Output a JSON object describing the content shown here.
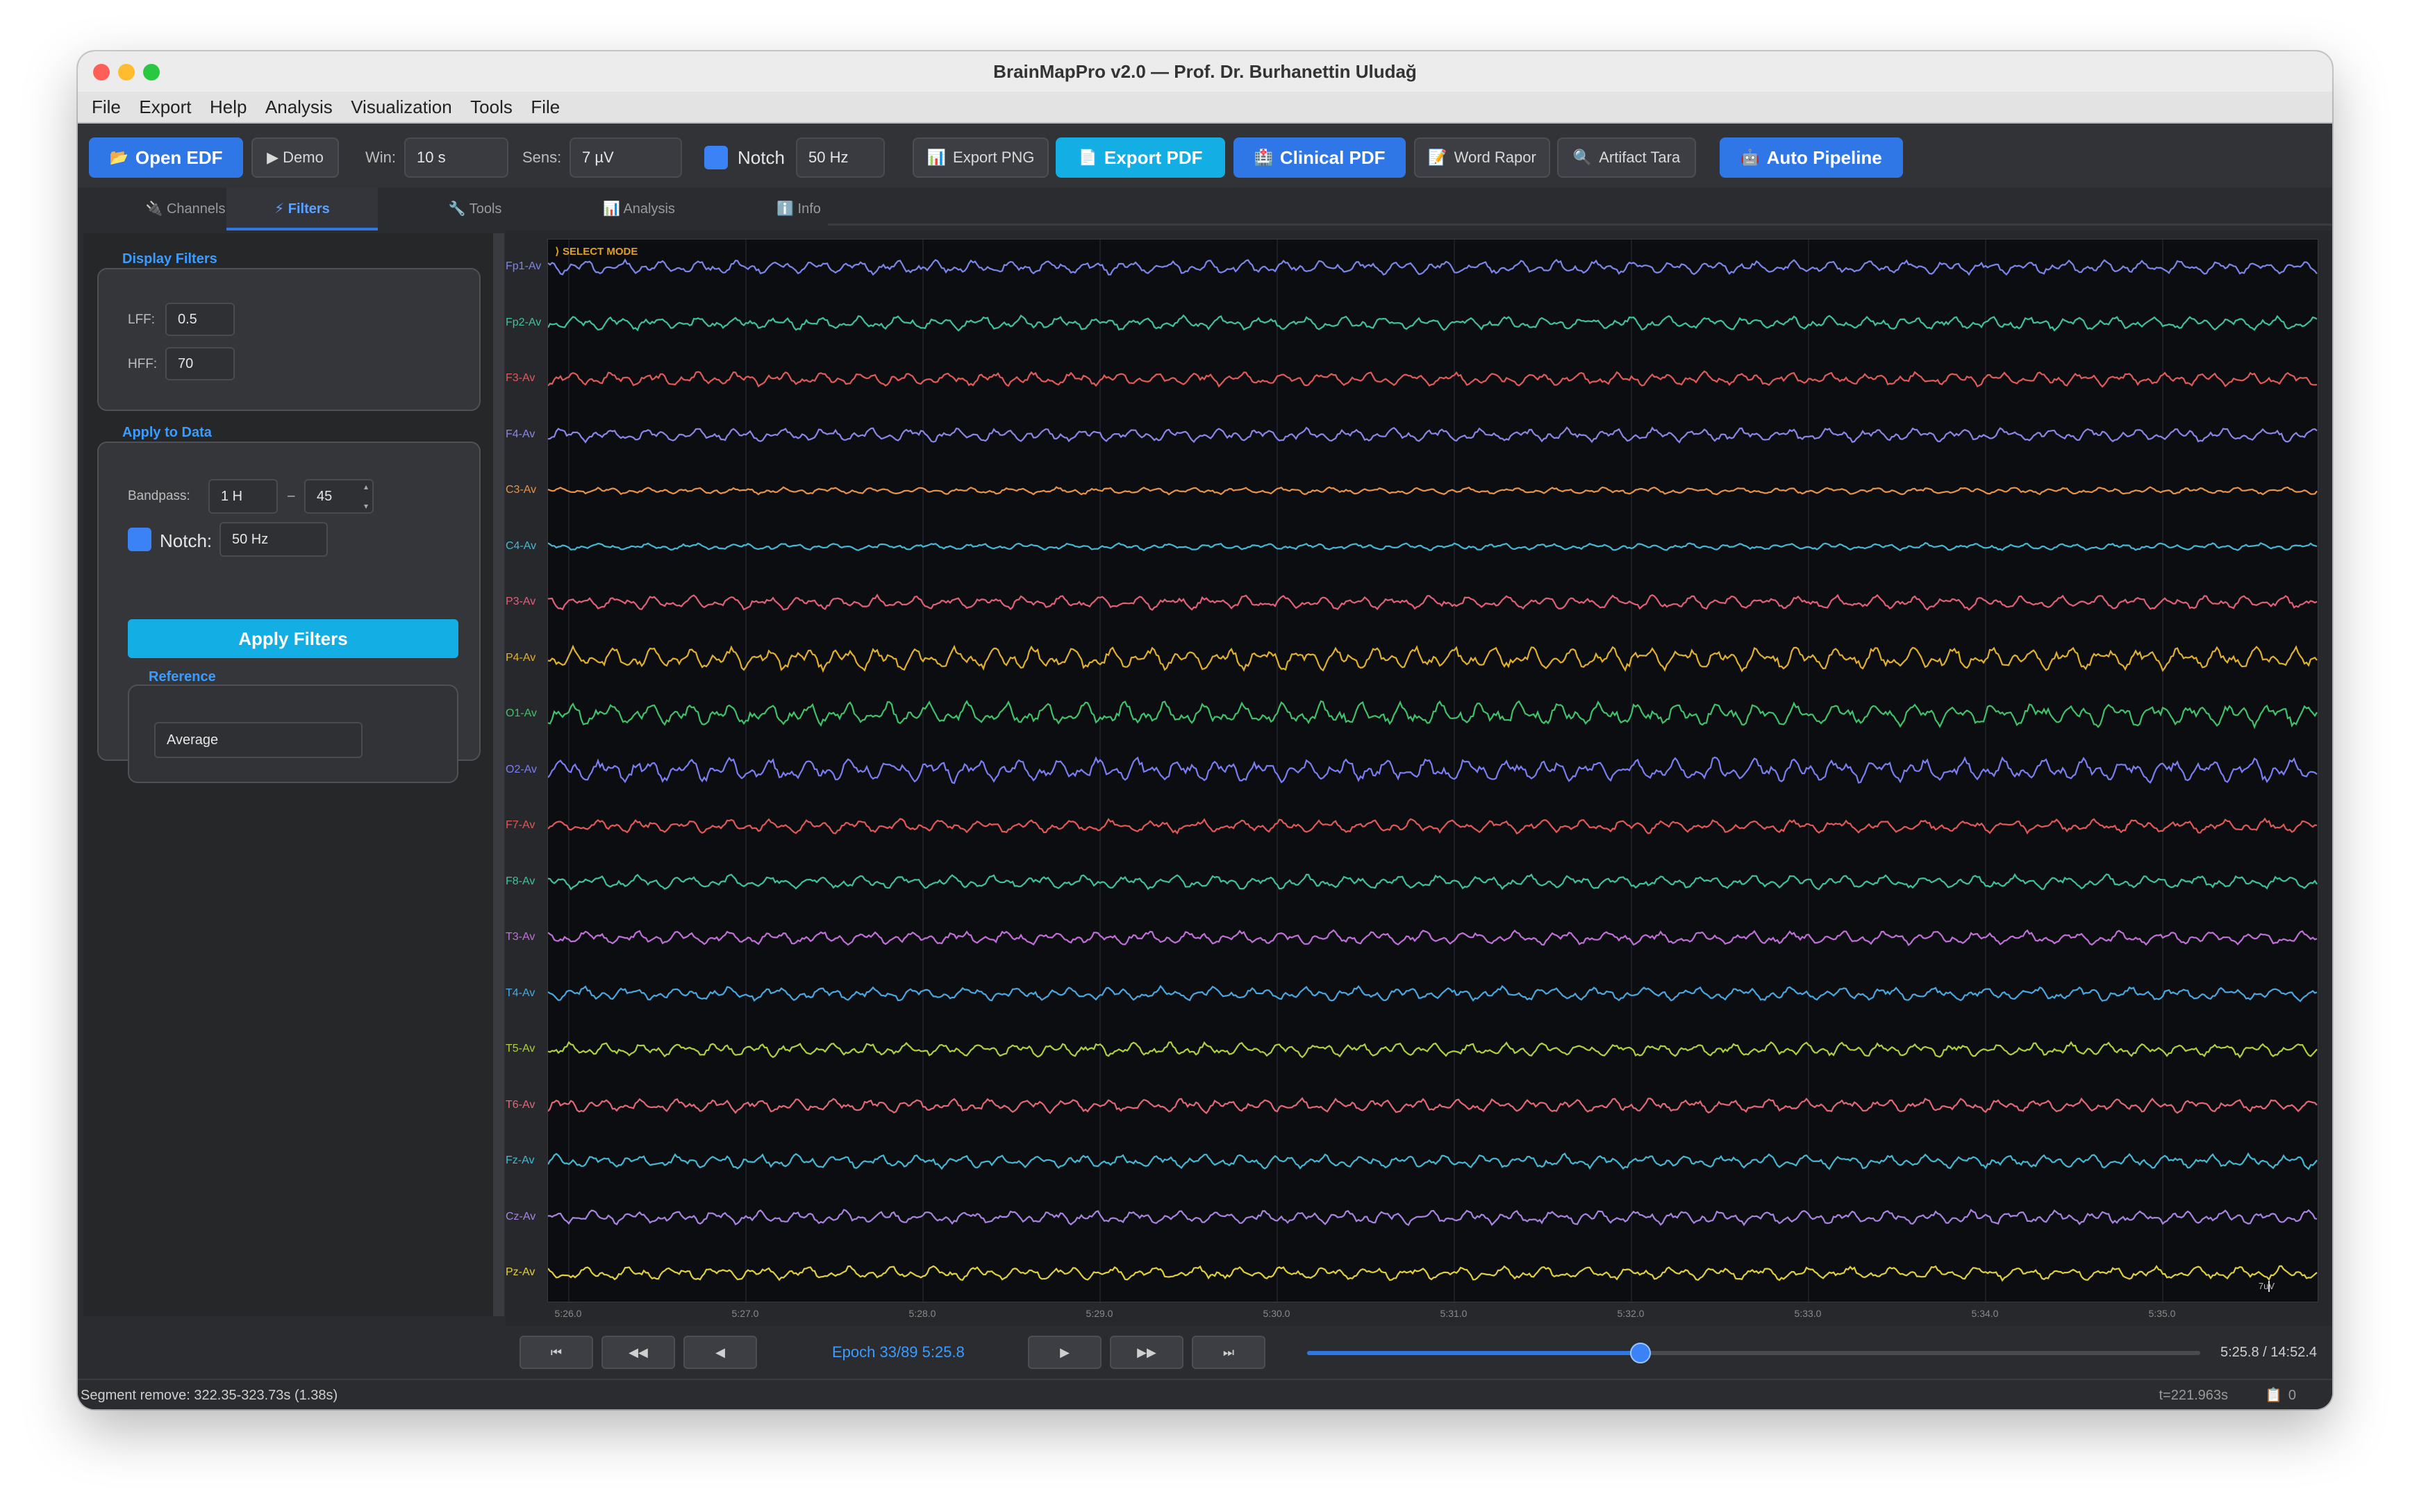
{
  "window": {
    "title": "BrainMapPro v2.0 — Prof. Dr. Burhanettin Uludağ"
  },
  "menu": [
    "File",
    "Export",
    "Help",
    "Analysis",
    "Visualization",
    "Tools",
    "File"
  ],
  "toolbar": {
    "open_edf": "Open EDF",
    "demo": "▶ Demo",
    "win_label": "Win:",
    "win_value": "10 s",
    "sens_label": "Sens:",
    "sens_value": "7 µV",
    "notch_label": "Notch",
    "notch_value": "50 Hz",
    "export_png": "Export PNG",
    "export_pdf": "Export PDF",
    "clinical_pdf": "Clinical PDF",
    "word_rapor": "Word Rapor",
    "artifact_tara": "Artifact Tara",
    "auto_pipeline": "Auto Pipeline"
  },
  "tabs": [
    {
      "icon": "🔌",
      "label": "Channels"
    },
    {
      "icon": "⚡",
      "label": "Filters"
    },
    {
      "icon": "🔧",
      "label": "Tools"
    },
    {
      "icon": "📊",
      "label": "Analysis"
    },
    {
      "icon": "ℹ️",
      "label": "Info"
    }
  ],
  "filters": {
    "display_title": "Display Filters",
    "lff_label": "LFF:",
    "lff_value": "0.5",
    "hff_label": "HFF:",
    "hff_value": "70",
    "apply_title": "Apply to Data",
    "bandpass_label": "Bandpass:",
    "bandpass_low": "1 H",
    "bandpass_sep": "–",
    "bandpass_high": "45",
    "notch_label": "Notch:",
    "notch_value": "50 Hz",
    "apply_button": "Apply Filters",
    "reference_title": "Reference",
    "reference_value": "Average"
  },
  "eeg": {
    "mode": "⟩ SELECT MODE",
    "scale": "7uV",
    "channels": [
      {
        "name": "Fp1-Av",
        "color": "#7b86e8"
      },
      {
        "name": "Fp2-Av",
        "color": "#3fc29a"
      },
      {
        "name": "F3-Av",
        "color": "#e05a5a"
      },
      {
        "name": "F4-Av",
        "color": "#8a86e6"
      },
      {
        "name": "C3-Av",
        "color": "#e8934a"
      },
      {
        "name": "C4-Av",
        "color": "#45b8d4"
      },
      {
        "name": "P3-Av",
        "color": "#e0607a"
      },
      {
        "name": "P4-Av",
        "color": "#e0b030"
      },
      {
        "name": "O1-Av",
        "color": "#3fc26a"
      },
      {
        "name": "O2-Av",
        "color": "#7a7ef0"
      },
      {
        "name": "F7-Av",
        "color": "#e05858"
      },
      {
        "name": "F8-Av",
        "color": "#3fc29a"
      },
      {
        "name": "T3-Av",
        "color": "#c070d8"
      },
      {
        "name": "T4-Av",
        "color": "#4aa8e0"
      },
      {
        "name": "T5-Av",
        "color": "#b0d040"
      },
      {
        "name": "T6-Av",
        "color": "#e06878"
      },
      {
        "name": "Fz-Av",
        "color": "#45b8d4"
      },
      {
        "name": "Cz-Av",
        "color": "#a884e0"
      },
      {
        "name": "Pz-Av",
        "color": "#e0d040"
      }
    ],
    "x_ticks": [
      "5:26.0",
      "5:27.0",
      "5:28.0",
      "5:29.0",
      "5:30.0",
      "5:31.0",
      "5:32.0",
      "5:33.0",
      "5:34.0",
      "5:35.0"
    ]
  },
  "nav": {
    "first": "⏮",
    "rewind": "◀◀",
    "prev": "◀",
    "epoch": "Epoch 33/89  5:25.8",
    "next": "▶",
    "forward": "▶▶",
    "last": "⏭",
    "position": 0.373,
    "time": "5:25.8 / 14:52.4"
  },
  "status": {
    "left": "Segment remove: 322.35-323.73s (1.38s)",
    "t": "t=221.963s",
    "count": "0"
  }
}
